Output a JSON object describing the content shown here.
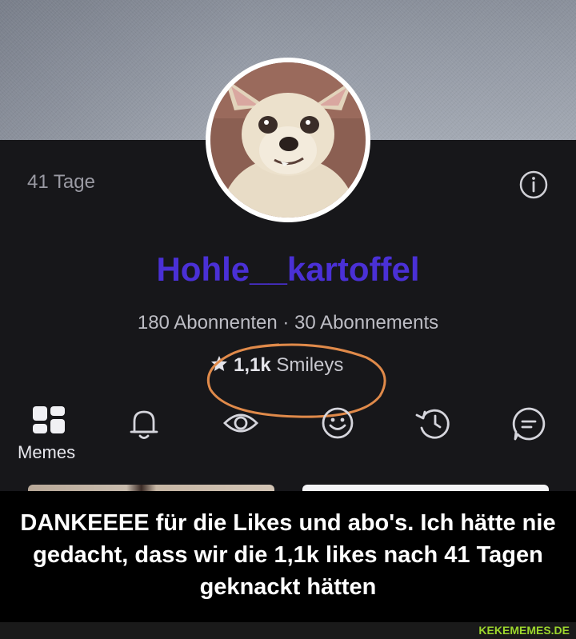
{
  "profile": {
    "days_label": "41 Tage",
    "username": "Hohle__kartoffel",
    "followers_line": "180 Abonnenten · 30 Abonnements",
    "smileys_count": "1,1k",
    "smileys_label": "Smileys",
    "username_color": "#4a30d6"
  },
  "tabs": [
    {
      "icon": "grid-icon",
      "label": "Memes",
      "active": true
    },
    {
      "icon": "bell-icon"
    },
    {
      "icon": "eye-icon"
    },
    {
      "icon": "smiley-icon"
    },
    {
      "icon": "history-icon"
    },
    {
      "icon": "chat-icon"
    }
  ],
  "caption": {
    "text": "DANKEEEE für die Likes und abo's. Ich hätte nie gedacht, dass wir die 1,1k likes nach 41 Tagen geknackt hätten"
  },
  "watermark": "KEKEMEMES.DE",
  "colors": {
    "background": "#17171a",
    "annotation_circle": "#e08a4a",
    "watermark": "#9cd62c"
  }
}
